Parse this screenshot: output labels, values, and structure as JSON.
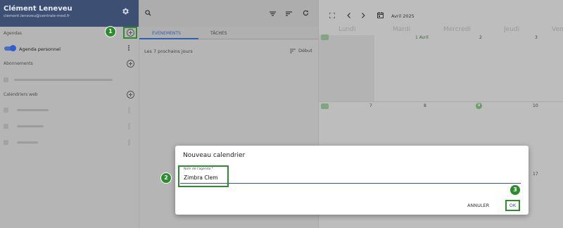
{
  "sidebar": {
    "user_name": "Clément Leneveu",
    "user_email": "clement.leneveu@centrale-med.fr",
    "agendas_label": "Agendas",
    "agenda_personnel": "Agenda personnel",
    "abonnements_label": "Abonnements",
    "calendriers_web_label": "Calendriers web"
  },
  "events_pane": {
    "tabs": [
      {
        "label": "ÉVÉNEMENTS"
      },
      {
        "label": "TÂCHES"
      }
    ],
    "next_days_label": "Les 7 prochains jours",
    "start_label": "Début"
  },
  "calendar": {
    "month_label": "Avril 2025",
    "day_headers": [
      "Lundi",
      "Mardi",
      "Mercredi",
      "Jeudi",
      "Vend"
    ],
    "week1_numbers": [
      "1 Avril",
      "2",
      "3"
    ],
    "week2_numbers": [
      "7",
      "8",
      "9",
      "10"
    ],
    "partial_number": "17"
  },
  "dialog": {
    "title": "Nouveau calendrier",
    "field_label": "Nom de l'agenda *",
    "field_value": "Zimbra Clem",
    "cancel_label": "ANNULER",
    "ok_label": "OK"
  },
  "annotations": {
    "step1": "1",
    "step2": "2",
    "step3": "3",
    "color": "#2e8b2e"
  },
  "colors": {
    "header_bg": "#3d4f72",
    "accent_blue": "#2f5fb3",
    "annotation_green": "#2e8b2e"
  },
  "icons": [
    "gear-icon",
    "add-calendar-icon",
    "search-icon",
    "filter-icon",
    "sort-icon",
    "refresh-icon",
    "fullscreen-icon",
    "chevron-left-icon",
    "chevron-right-icon",
    "calendar-icon",
    "sort-lines-icon"
  ]
}
